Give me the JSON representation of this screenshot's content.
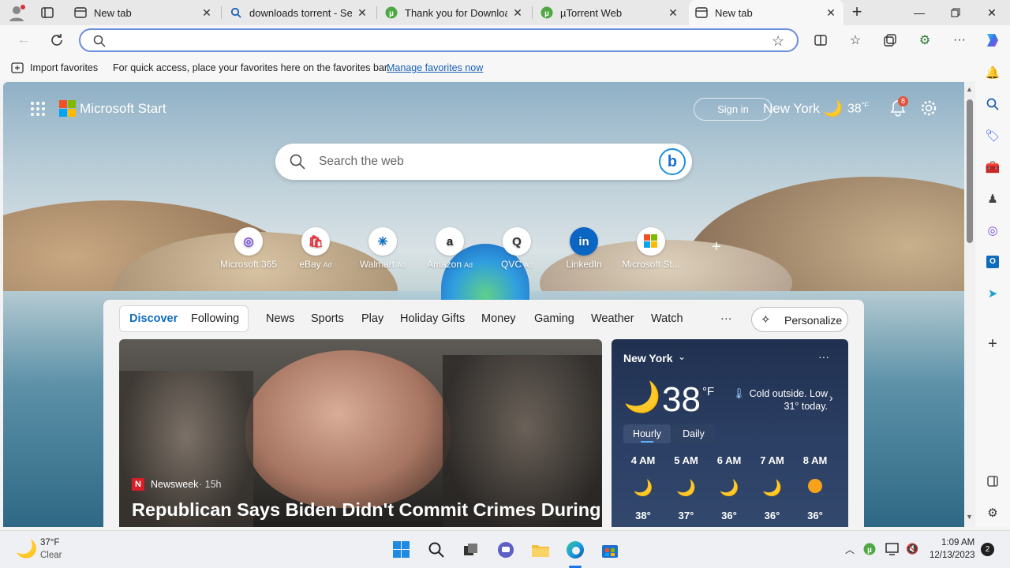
{
  "tabs": [
    {
      "title": "New tab",
      "icon": "new-tab-icon"
    },
    {
      "title": "downloads torrent - Sear",
      "icon": "search-icon"
    },
    {
      "title": "Thank you for Download",
      "icon": "utorrent-icon"
    },
    {
      "title": "µTorrent Web",
      "icon": "utorrent-icon"
    },
    {
      "title": "New tab",
      "icon": "new-tab-icon"
    }
  ],
  "address": {
    "value": "",
    "placeholder": ""
  },
  "favorites_bar": {
    "import_label": "Import favorites",
    "message": "For quick access, place your favorites here on the favorites bar.",
    "manage_link": "Manage favorites now"
  },
  "ms_start": {
    "brand": "Microsoft Start",
    "sign_in": "Sign in",
    "location": "New York",
    "temp": "38",
    "temp_unit": "°F",
    "notifications": "8",
    "search_placeholder": "Search the web",
    "quick_links": [
      {
        "label": "Microsoft 365",
        "ad": ""
      },
      {
        "label": "eBay",
        "ad": "Ad"
      },
      {
        "label": "Walmart",
        "ad": "Ad"
      },
      {
        "label": "Amazon",
        "ad": "Ad"
      },
      {
        "label": "QVC",
        "ad": "Ad"
      },
      {
        "label": "LinkedIn",
        "ad": ""
      },
      {
        "label": "Microsoft St...",
        "ad": ""
      }
    ],
    "add_label": "+",
    "nav": {
      "discover": "Discover",
      "following": "Following",
      "items": [
        "News",
        "Sports",
        "Play",
        "Holiday Gifts",
        "Money",
        "Gaming",
        "Weather",
        "Watch"
      ],
      "more": "···",
      "personalize": "Personalize"
    },
    "article": {
      "source": "Newsweek",
      "age": "· 15h",
      "headline": "Republican Says Biden Didn't Commit Crimes During"
    },
    "weather": {
      "city": "New York",
      "temp": "38",
      "unit": "°F",
      "summary": "Cold outside. Low 31° today.",
      "tab_hourly": "Hourly",
      "tab_daily": "Daily",
      "more": "···",
      "hours": [
        {
          "time": "4 AM",
          "temp": "38°",
          "icon": "moon-icon"
        },
        {
          "time": "5 AM",
          "temp": "37°",
          "icon": "moon-icon"
        },
        {
          "time": "6 AM",
          "temp": "36°",
          "icon": "moon-icon"
        },
        {
          "time": "7 AM",
          "temp": "36°",
          "icon": "moon-icon"
        },
        {
          "time": "8 AM",
          "temp": "36°",
          "icon": "sun-icon"
        }
      ]
    }
  },
  "taskbar": {
    "weather_temp": "37°F",
    "weather_desc": "Clear",
    "time": "1:09 AM",
    "date": "12/13/2023",
    "notif_count": "2"
  },
  "colors": {
    "accent": "#0f6cbd",
    "link": "#1a5fb4",
    "badge": "#e0533e"
  }
}
